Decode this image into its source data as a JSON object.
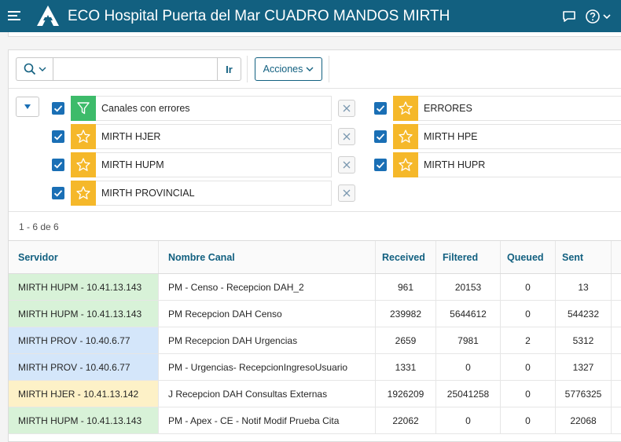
{
  "header": {
    "title": "ECO Hospital Puerta del Mar CUADRO MANDOS MIRTH"
  },
  "toolbar": {
    "search_value": "",
    "go_label": "Ir",
    "actions_label": "Acciones"
  },
  "filters": [
    {
      "label": "Canales con errores",
      "icon": "filter-icon",
      "checked": true
    },
    {
      "label": "ERRORES",
      "icon": "star-icon",
      "checked": true
    },
    {
      "label": "MIRTH HJER",
      "icon": "star-icon",
      "checked": true
    },
    {
      "label": "MIRTH HPE",
      "icon": "star-icon",
      "checked": true
    },
    {
      "label": "MIRTH HUPM",
      "icon": "star-icon",
      "checked": true
    },
    {
      "label": "MIRTH HUPR",
      "icon": "star-icon",
      "checked": true
    },
    {
      "label": "MIRTH PROVINCIAL",
      "icon": "star-icon",
      "checked": true
    }
  ],
  "pagination": {
    "range_text": "1 - 6 de 6"
  },
  "table": {
    "columns": [
      "Servidor",
      "Nombre Canal",
      "Received",
      "Filtered",
      "Queued",
      "Sent"
    ],
    "rows": [
      {
        "servidor": "MIRTH HUPM - 10.41.13.143",
        "canal": "PM - Censo - Recepcion DAH_2",
        "received": "961",
        "filtered": "20153",
        "queued": "0",
        "sent": "13",
        "color": "green"
      },
      {
        "servidor": "MIRTH HUPM - 10.41.13.143",
        "canal": "PM Recepcion DAH Censo",
        "received": "239982",
        "filtered": "5644612",
        "queued": "0",
        "sent": "544232",
        "color": "green"
      },
      {
        "servidor": "MIRTH PROV - 10.40.6.77",
        "canal": "PM Recepcion DAH Urgencias",
        "received": "2659",
        "filtered": "7981",
        "queued": "2",
        "sent": "5312",
        "color": "blue"
      },
      {
        "servidor": "MIRTH PROV - 10.40.6.77",
        "canal": "PM - Urgencias- RecepcionIngresoUsuario",
        "received": "1331",
        "filtered": "0",
        "queued": "0",
        "sent": "1327",
        "color": "blue"
      },
      {
        "servidor": "MIRTH HJER - 10.41.13.142",
        "canal": "J Recepcion DAH Consultas Externas",
        "received": "1926209",
        "filtered": "25041258",
        "queued": "0",
        "sent": "5776325",
        "color": "yellow"
      },
      {
        "servidor": "MIRTH HUPM - 10.41.13.143",
        "canal": "PM - Apex - CE - Notif Modif Prueba Cita",
        "received": "22062",
        "filtered": "0",
        "queued": "0",
        "sent": "22068",
        "color": "green"
      }
    ]
  },
  "colors": {
    "header_bg": "#126080",
    "checkbox": "#1a6fb5",
    "filter_green": "#3dbb6a",
    "filter_yellow": "#f5b82a",
    "row_green": "#d8f2d8",
    "row_blue": "#d4e6fa",
    "row_yellow": "#fdf1c7"
  }
}
